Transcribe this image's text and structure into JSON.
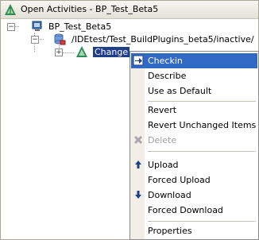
{
  "window": {
    "title": "Open Activities - BP_Test_Beta5"
  },
  "tree": {
    "root": {
      "label": "BP_Test_Beta5",
      "expander": "−"
    },
    "folder": {
      "label": "/IDEtest/Test_BuildPlugins_beta5/inactive/",
      "expander": "−"
    },
    "change": {
      "label": "Change",
      "expander": "+"
    }
  },
  "context_menu": {
    "items": [
      {
        "label": "Checkin",
        "icon": "checkin-icon",
        "state": "highlighted"
      },
      {
        "label": "Describe"
      },
      {
        "label": "Use as Default"
      },
      {
        "label": "Revert"
      },
      {
        "label": "Revert Unchanged Items"
      },
      {
        "label": "Delete",
        "icon": "delete-icon",
        "state": "disabled"
      },
      {
        "label": "Upload",
        "icon": "arrow-up-icon"
      },
      {
        "label": "Forced Upload"
      },
      {
        "label": "Download",
        "icon": "arrow-down-icon"
      },
      {
        "label": "Forced Download"
      },
      {
        "label": "Properties"
      }
    ]
  },
  "colors": {
    "highlight": "#316ac5",
    "selection": "#1f3f8a",
    "menu_gutter": "#f1efe8"
  }
}
